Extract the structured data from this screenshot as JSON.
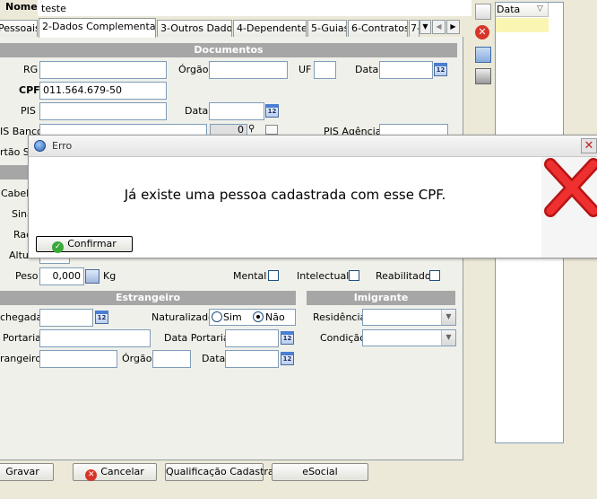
{
  "header": {
    "nome_label": "Nome",
    "nome_value": "teste"
  },
  "tabs": [
    "Pessoais",
    "2-Dados Complementares",
    "3-Outros Dados",
    "4-Dependentes",
    "5-Guias",
    "6-Contratos",
    "7-"
  ],
  "documentos": {
    "section_title": "Documentos",
    "rg_label": "RG",
    "rg_value": "",
    "orgao_label": "Órgão",
    "orgao_value": "",
    "uf_label": "UF",
    "uf_value": "",
    "data_label": "Data",
    "data_value": "",
    "cpf_label": "CPF",
    "cpf_value": "011.564.679-50",
    "pis_label": "PIS",
    "pis_value": "",
    "pis_data_label": "Data",
    "pis_data_value": "",
    "pis_banco_label": "IS Banco",
    "pis_banco_value": "",
    "pis_banco_num": "0",
    "pis_agencia_label": "PIS Agência",
    "pis_agencia_value": "",
    "cartao_label": "rtão SU"
  },
  "fisico": {
    "cabelo_label": "Cabelo",
    "sinais_label": "Sina",
    "raca_label": "Rac",
    "altura_label": "Altu",
    "peso_label": "Peso",
    "peso_value": "0,000",
    "peso_unit": "Kg",
    "mental_label": "Mental",
    "intelectual_label": "Intelectual",
    "reabilitado_label": "Reabilitado"
  },
  "estrangeiro": {
    "section_title": "Estrangeiro",
    "chegada_label": "chegada",
    "chegada_value": "",
    "naturalizado_label": "Naturalizado",
    "sim_label": "Sim",
    "nao_label": "Não",
    "portaria_label": "Portaria",
    "portaria_value": "",
    "data_portaria_label": "Data Portaria",
    "data_portaria_value": "",
    "rne_label": "rangeiro",
    "rne_value": "",
    "orgao_label": "Órgão",
    "orgao_value": "",
    "data_label": "Data",
    "data_value": ""
  },
  "imigrante": {
    "section_title": "Imigrante",
    "residencia_label": "Residência",
    "residencia_value": "",
    "condicao_label": "Condição",
    "condicao_value": ""
  },
  "side_panel": {
    "column_header": "Data"
  },
  "footer": {
    "gravar": "Gravar",
    "cancelar": "Cancelar",
    "qualificacao": "Qualificação Cadastral",
    "esocial": "eSocial"
  },
  "dialog": {
    "title": "Erro",
    "message": "Já existe uma pessoa cadastrada com esse CPF.",
    "confirm": "Confirmar"
  }
}
